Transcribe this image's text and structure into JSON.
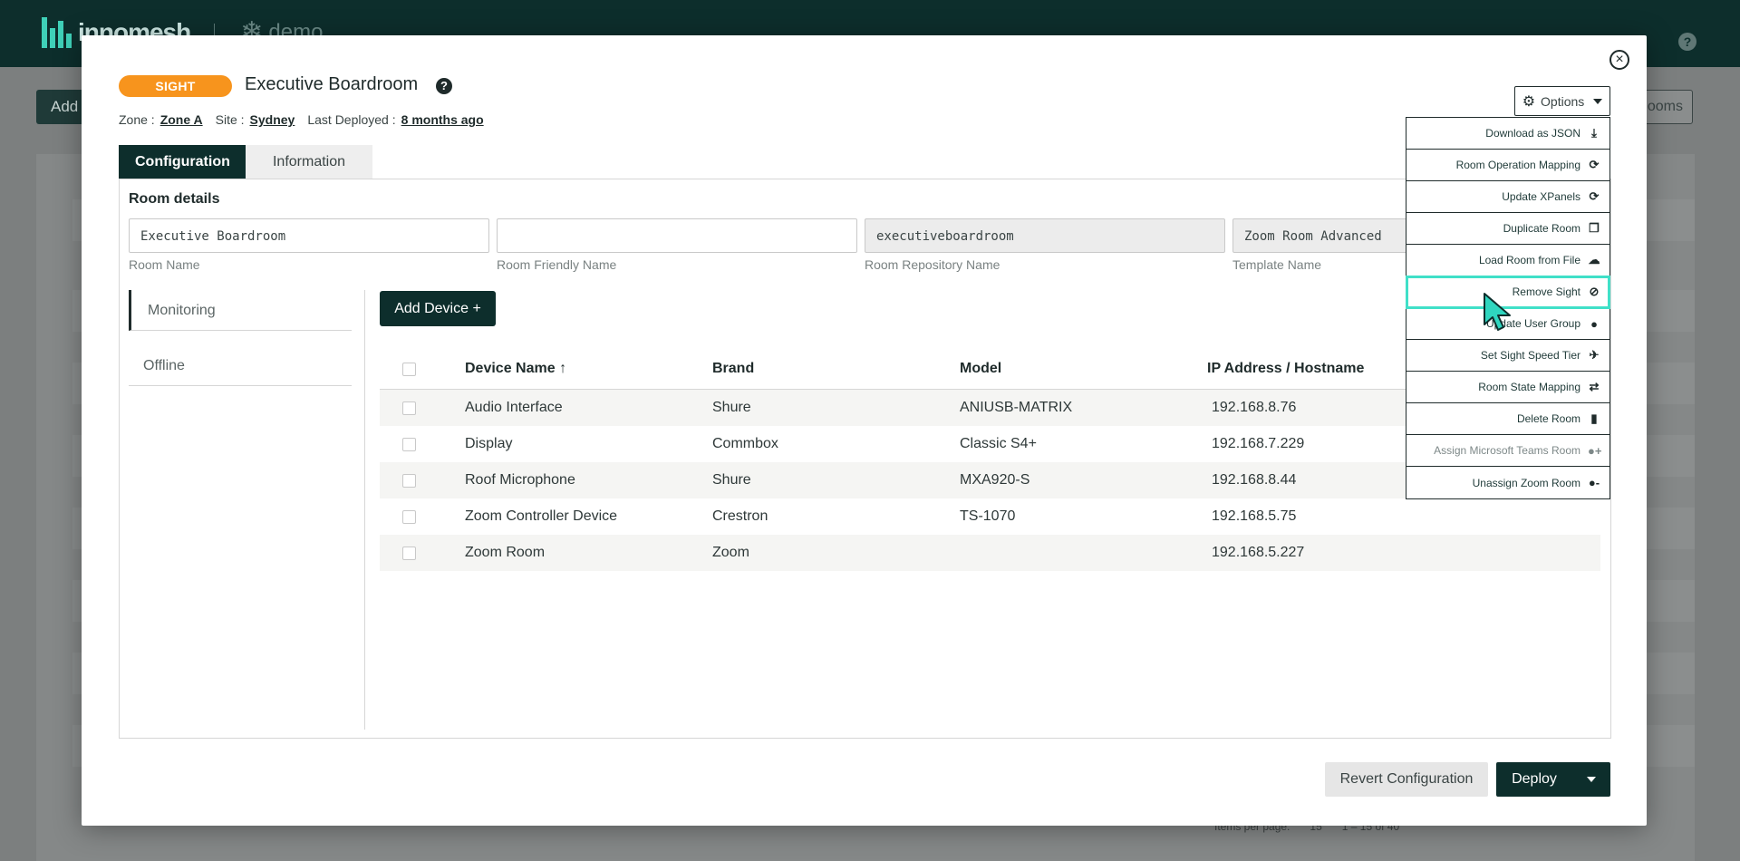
{
  "app": {
    "logo_text": "innomesh",
    "workspace": "demo",
    "bg_add_label": "Add",
    "bg_rooms_label": "ooms",
    "pagination": {
      "items_per_page_label": "Items per page:",
      "items_per_page": "15",
      "range": "1 – 15 of 40"
    }
  },
  "modal": {
    "badge": "SIGHT",
    "title": "Executive Boardroom",
    "meta": {
      "zone_label": "Zone :",
      "zone": "Zone A",
      "site_label": "Site :",
      "site": "Sydney",
      "deployed_label": "Last Deployed :",
      "deployed": "8 months ago"
    },
    "tabs": [
      "Configuration",
      "Information"
    ],
    "room_details": {
      "title": "Room details",
      "fields": [
        {
          "label": "Room Name",
          "value": "Executive Boardroom"
        },
        {
          "label": "Room Friendly Name",
          "value": ""
        },
        {
          "label": "Room Repository Name",
          "value": "executiveboardroom"
        },
        {
          "label": "Template Name",
          "value": "Zoom Room Advanced"
        }
      ]
    },
    "side_nav": [
      "Monitoring",
      "Offline"
    ],
    "add_device_label": "Add Device +",
    "table": {
      "headers": [
        "Device Name ↑",
        "Brand",
        "Model",
        "IP Address / Hostname"
      ],
      "rows": [
        {
          "name": "Audio Interface",
          "brand": "Shure",
          "model": "ANIUSB-MATRIX",
          "ip": "192.168.8.76"
        },
        {
          "name": "Display",
          "brand": "Commbox",
          "model": "Classic S4+",
          "ip": "192.168.7.229"
        },
        {
          "name": "Roof Microphone",
          "brand": "Shure",
          "model": "MXA920-S",
          "ip": "192.168.8.44"
        },
        {
          "name": "Zoom Controller Device",
          "brand": "Crestron",
          "model": "TS-1070",
          "ip": "192.168.5.75"
        },
        {
          "name": "Zoom Room",
          "brand": "Zoom",
          "model": "",
          "ip": "192.168.5.227"
        }
      ]
    },
    "options": {
      "label": "Options",
      "items": [
        {
          "label": "Download as JSON",
          "icon": "download-icon"
        },
        {
          "label": "Room Operation Mapping",
          "icon": "sync-icon"
        },
        {
          "label": "Update XPanels",
          "icon": "sync-icon"
        },
        {
          "label": "Duplicate Room",
          "icon": "copy-icon"
        },
        {
          "label": "Load Room from File",
          "icon": "cloud-upload-icon"
        },
        {
          "label": "Remove Sight",
          "icon": "eye-slash-icon"
        },
        {
          "label": "Update User Group",
          "icon": "user-icon"
        },
        {
          "label": "Set Sight Speed Tier",
          "icon": "plane-icon"
        },
        {
          "label": "Room State Mapping",
          "icon": "exchange-icon"
        },
        {
          "label": "Delete Room",
          "icon": "trash-icon"
        },
        {
          "label": "Assign Microsoft Teams Room",
          "icon": "user-plus-icon"
        },
        {
          "label": "Unassign Zoom Room",
          "icon": "user-minus-icon"
        }
      ]
    },
    "footer": {
      "revert_label": "Revert Configuration",
      "deploy_label": "Deploy"
    }
  },
  "colors": {
    "brand_dark": "#0d2e2c",
    "badge_orange": "#f7941d",
    "highlight": "#40e0c8"
  }
}
